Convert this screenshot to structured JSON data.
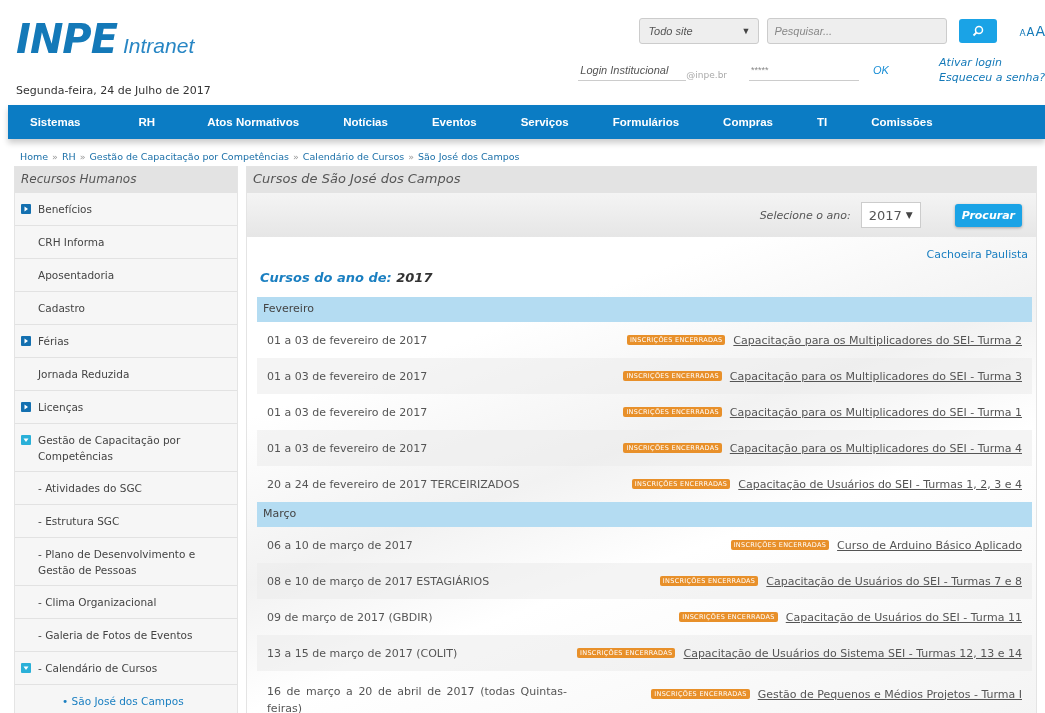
{
  "logo": {
    "mark": "INPE",
    "word": "Intranet"
  },
  "scope_select": {
    "value": "Todo site",
    "caret": "▼"
  },
  "search": {
    "placeholder": "Pesquisar..."
  },
  "font_sizes": [
    "A",
    "A",
    "A"
  ],
  "date": "Segunda-feira, 24 de Julho de 2017",
  "login": {
    "user_placeholder": "Login Institucional",
    "domain": "@inpe.br",
    "password": "*****",
    "submit": "OK",
    "links": [
      "Ativar login",
      "Esqueceu a senha?"
    ]
  },
  "nav": [
    "Sistemas",
    "RH",
    "Atos Normativos",
    "Notícias",
    "Eventos",
    "Serviços",
    "Formulários",
    "Compras",
    "TI",
    "Comissões"
  ],
  "breadcrumb": {
    "separator": "»",
    "items": [
      "Home",
      "RH",
      "Gestão de Capacitação por Competências",
      "Calendário de Cursos",
      "São José dos Campos"
    ]
  },
  "sidebar": {
    "title": "Recursos Humanos",
    "items": [
      {
        "label": "Benefícios",
        "kind": "folder",
        "expanded": false,
        "selected": false
      },
      {
        "label": "CRH Informa",
        "kind": "page",
        "selected": false
      },
      {
        "label": "Aposentadoria",
        "kind": "page",
        "selected": false
      },
      {
        "label": "Cadastro",
        "kind": "page",
        "selected": false
      },
      {
        "label": "Férias",
        "kind": "folder",
        "expanded": false,
        "selected": false
      },
      {
        "label": "Jornada Reduzida",
        "kind": "page",
        "selected": false
      },
      {
        "label": "Licenças",
        "kind": "folder",
        "expanded": false,
        "selected": false
      },
      {
        "label": "Gestão de Capacitação por Competências",
        "kind": "folder",
        "expanded": true,
        "selected": false,
        "children": [
          {
            "label": "- Atividades do SGC",
            "kind": "page",
            "selected": false
          },
          {
            "label": "- Estrutura SGC",
            "kind": "page",
            "selected": false
          },
          {
            "label": "- Plano de Desenvolvimento e Gestão de Pessoas",
            "kind": "page",
            "selected": false
          },
          {
            "label": "- Clima Organizacional",
            "kind": "page",
            "selected": false
          },
          {
            "label": "- Galeria de Fotos de Eventos",
            "kind": "page",
            "selected": false
          },
          {
            "label": "- Calendário de Cursos",
            "kind": "folder",
            "expanded": true,
            "selected": false,
            "children": [
              {
                "label": "• São José dos Campos",
                "kind": "page",
                "selected": true
              }
            ]
          }
        ]
      }
    ]
  },
  "main": {
    "title": "Cursos de São José dos Campos",
    "year_label": "Selecione o ano:",
    "year": "2017",
    "year_caret": "▼",
    "search_button": "Procurar",
    "other_site": "Cachoeira Paulista",
    "heading": "Cursos do ano de:",
    "heading_year": "2017",
    "months": [
      {
        "name": "Fevereiro",
        "courses": [
          {
            "date": "01 a 03 de fevereiro de 2017",
            "status": "INSCRIÇÕES ENCERRADAS",
            "title": "Capacitação para os Multiplicadores do SEI- Turma 2"
          },
          {
            "date": "01 a 03 de fevereiro de 2017",
            "status": "INSCRIÇÕES ENCERRADAS",
            "title": "Capacitação para os Multiplicadores do SEI - Turma 3"
          },
          {
            "date": "01 a 03 de fevereiro de 2017",
            "status": "INSCRIÇÕES ENCERRADAS",
            "title": "Capacitação para os Multiplicadores do SEI - Turma 1"
          },
          {
            "date": "01 a 03 de fevereiro de 2017",
            "status": "INSCRIÇÕES ENCERRADAS",
            "title": "Capacitação para os Multiplicadores do SEI - Turma 4"
          },
          {
            "date": "20 a 24 de fevereiro de 2017 TERCEIRIZADOS",
            "status": "INSCRIÇÕES ENCERRADAS",
            "title": "Capacitação de Usuários do SEI - Turmas 1, 2, 3 e 4"
          }
        ]
      },
      {
        "name": "Março",
        "courses": [
          {
            "date": "06 a 10 de março de 2017",
            "status": "INSCRIÇÕES ENCERRADAS",
            "title": "Curso de Arduino Básico Aplicado"
          },
          {
            "date": "08 e 10 de março de 2017 ESTAGIÁRIOS",
            "status": "INSCRIÇÕES ENCERRADAS",
            "title": "Capacitação de Usuários do SEI - Turmas 7 e 8"
          },
          {
            "date": "09 de março de 2017 (GBDIR)",
            "status": "INSCRIÇÕES ENCERRADAS",
            "title": "Capacitação de Usuários do SEI - Turma 11"
          },
          {
            "date": "13 a 15 de março de 2017 (COLIT)",
            "status": "INSCRIÇÕES ENCERRADAS",
            "title": "Capacitação de Usuários do Sistema SEI - Turmas 12, 13 e 14"
          },
          {
            "date": "16 de março a 20 de abril de 2017 (todas Quintas-feiras)",
            "status": "INSCRIÇÕES ENCERRADAS",
            "title": "Gestão de Pequenos e Médios Projetos - Turma I"
          }
        ]
      }
    ]
  }
}
